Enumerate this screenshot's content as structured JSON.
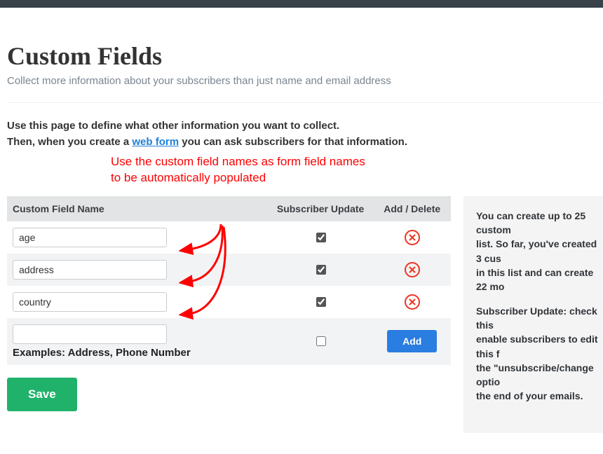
{
  "header": {
    "title": "Custom Fields",
    "subtitle": "Collect more information about your subscribers than just name and email address"
  },
  "intro": {
    "line1": "Use this page to define what other information you want to collect.",
    "line2_pre": "Then, when you create a ",
    "line2_link": "web form",
    "line2_post": " you can ask subscribers for that information."
  },
  "annotation": {
    "line1": "Use the custom field names as form field names",
    "line2": "to be automatically populated"
  },
  "table": {
    "col_name": "Custom Field Name",
    "col_update": "Subscriber Update",
    "col_actions": "Add / Delete"
  },
  "rows": [
    {
      "value": "age",
      "checked": true
    },
    {
      "value": "address",
      "checked": true
    },
    {
      "value": "country",
      "checked": true
    }
  ],
  "new_row": {
    "value": "",
    "examples": "Examples: Address, Phone Number",
    "add_label": "Add"
  },
  "buttons": {
    "save": "Save"
  },
  "sidebar": {
    "p1a": "You can create up to ",
    "p1b": "25 custom ",
    "p1c": "list. So far, you've created ",
    "p1d": "3 cus",
    "p1e": "in this list and can create ",
    "p1f": "22 mo",
    "p2a": "Subscriber Update:",
    "p2b": " check this ",
    "p2c": "enable subscribers to edit this f",
    "p2d": "the \"unsubscribe/change optio",
    "p2e": "the end of your emails."
  }
}
